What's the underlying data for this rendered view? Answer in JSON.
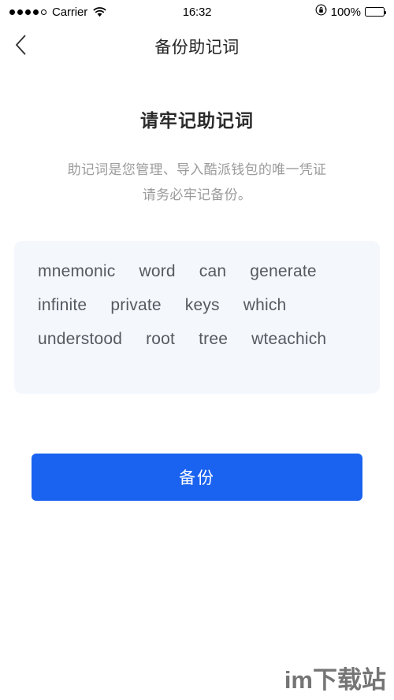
{
  "status_bar": {
    "signal_dots_filled": 4,
    "signal_dots_total": 5,
    "carrier": "Carrier",
    "wifi_icon": "wifi-icon",
    "time": "16:32",
    "rotation_lock_icon": "rotation-lock-icon",
    "battery_percent": "100%",
    "battery_level": 100
  },
  "nav": {
    "back_icon": "chevron-left-icon",
    "title": "备份助记词"
  },
  "main": {
    "headline": "请牢记助记词",
    "subtitle_line1": "助记词是您管理、导入酷派钱包的唯一凭证",
    "subtitle_line2": "请务必牢记备份。",
    "mnemonic_words": [
      "mnemonic",
      "word",
      "can",
      "generate",
      "infinite",
      "private",
      "keys",
      "which",
      "understood",
      "root",
      "tree",
      "wteachich"
    ],
    "backup_button_label": "备份"
  },
  "watermark": "im下载站",
  "colors": {
    "accent": "#1a62f0",
    "mnemonic_box_bg": "#f4f7fc",
    "word_text": "#555a61",
    "subtitle_text": "#9b9b9b",
    "headline_text": "#2b2b2b",
    "watermark_text": "#757575"
  }
}
